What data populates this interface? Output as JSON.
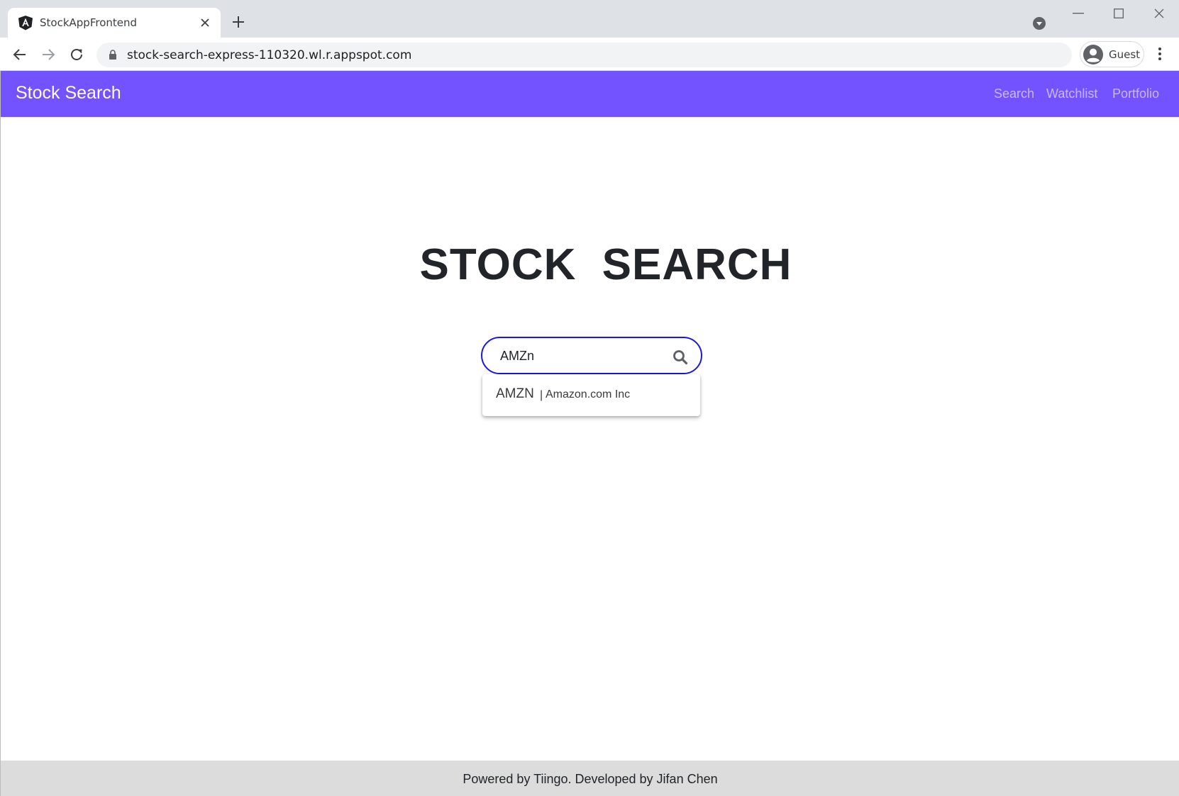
{
  "browser": {
    "tab_title": "StockAppFrontend",
    "url": "stock-search-express-110320.wl.r.appspot.com",
    "profile_name": "Guest",
    "icons": {
      "favicon": "angular-logo-icon",
      "tab_close": "close-icon",
      "new_tab": "plus-icon",
      "back": "arrow-left-icon",
      "forward": "arrow-right-icon",
      "reload": "reload-icon",
      "lock": "lock-icon",
      "avatar": "avatar-icon",
      "menu": "kebab-menu-icon"
    }
  },
  "navbar": {
    "brand": "Stock Search",
    "links": [
      "Search",
      "Watchlist",
      "Portfolio"
    ],
    "background": "#7352ff"
  },
  "hero": {
    "title": "STOCK SEARCH"
  },
  "search": {
    "value": "AMZn",
    "border_color": "#1a1adb",
    "suggestions": [
      {
        "ticker": "AMZN",
        "separator": "|",
        "name": "Amazon.com Inc"
      }
    ]
  },
  "footer": {
    "text": "Powered by Tiingo. Developed by Jifan Chen"
  }
}
